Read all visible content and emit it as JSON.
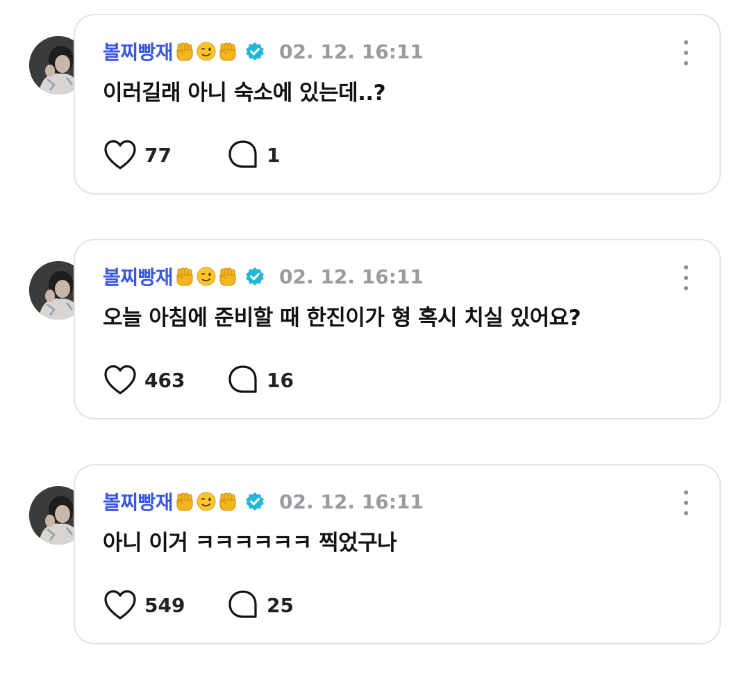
{
  "posts": [
    {
      "author": "볼찌빵재",
      "time": "02. 12. 16:11",
      "text": "이러길래 아니 숙소에 있는데..?",
      "likes": "77",
      "comments": "1"
    },
    {
      "author": "볼찌빵재",
      "time": "02. 12. 16:11",
      "text": "오늘 아침에 준비할 때 한진이가 형 혹시 치실 있어요?",
      "likes": "463",
      "comments": "16"
    },
    {
      "author": "볼찌빵재",
      "time": "02. 12. 16:11",
      "text": "아니 이거 ㅋㅋㅋㅋㅋㅋ 찍었구나",
      "likes": "549",
      "comments": "25"
    }
  ],
  "icons": {
    "author_emojis": [
      "raised-fist-icon",
      "winking-face-icon",
      "raised-fist-icon"
    ],
    "verified": "verified-badge-icon",
    "like": "heart-outline-icon",
    "comment": "speech-bubble-icon",
    "more": "vertical-dots-icon"
  },
  "colors": {
    "author_name": "#3a56e6",
    "verified_badge": "#22b7d4",
    "timestamp": "#9a9aa0",
    "card_border": "#e3e3e7"
  }
}
